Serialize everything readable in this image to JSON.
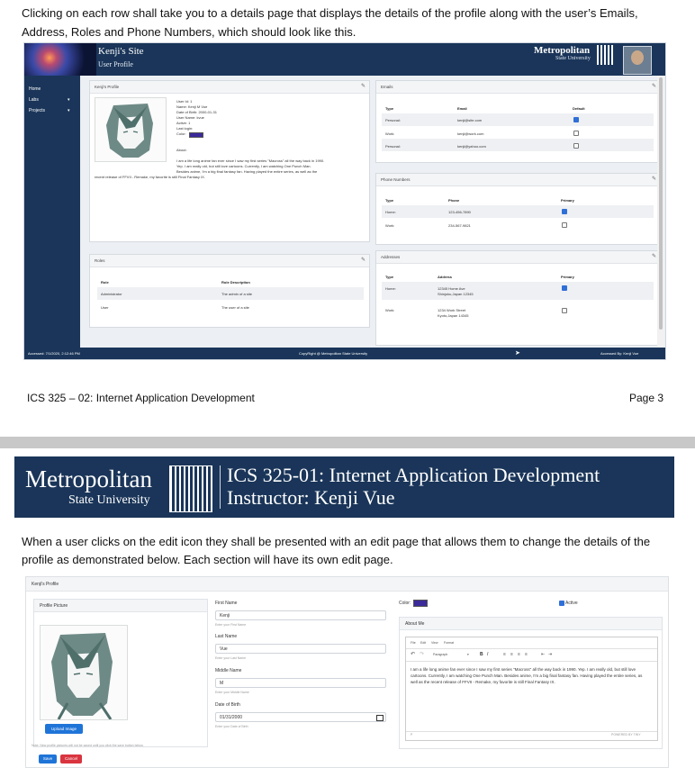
{
  "intro": "Clicking on each row shall take you to a details page that displays the details of the profile along with the user’s Emails, Address, Roles and Phone Numbers, which should look like this.",
  "shot1": {
    "site_title": "Kenji's Site",
    "site_subtitle": "User Profile",
    "logo_main": "Metropolitan",
    "logo_sub": "State University",
    "sidebar": [
      {
        "label": "Home",
        "chevron": ""
      },
      {
        "label": "Labs",
        "chevron": "▾"
      },
      {
        "label": "Projects",
        "chevron": "▾"
      }
    ],
    "edit_icon": "✎",
    "profile": {
      "header": "Kenji's Profile",
      "details": [
        "User Id: 1",
        "Name: Kenji M Vue",
        "Date of Birth: 2000-01-31",
        "User Name: kvue",
        "Active: 1",
        "Last login:",
        "Color:"
      ],
      "color": "#3b2a9a",
      "about_label": "About:",
      "about_lines": [
        "I am a life long anime fan ever since I saw my first series \"Macross\" all the way back in 1990.",
        "Yep. I am really old, but still love cartoons. Currently, I am watching One Punch Man.",
        "Besides anime, I'm a big final fantasy fan. Having played the entire series, as well as the",
        "recent release of FFVII - Remake, my favorite is still Final Fantasy IX."
      ]
    },
    "roles": {
      "header": "Roles",
      "columns": [
        "Role",
        "Role Description"
      ],
      "rows": [
        [
          "Administrator",
          "The admin of a site"
        ],
        [
          "User",
          "The user of a site"
        ]
      ]
    },
    "emails": {
      "header": "Emails",
      "columns": [
        "Type",
        "Email",
        "Default"
      ],
      "rows": [
        {
          "type": "Personal:",
          "value": "kenji@site.com",
          "checked": true
        },
        {
          "type": "Work:",
          "value": "kenji@work.com",
          "checked": false
        },
        {
          "type": "Personal:",
          "value": "kenji@yahoo.com",
          "checked": false
        }
      ]
    },
    "phones": {
      "header": "Phone Numbers",
      "columns": [
        "Type",
        "Phone",
        "Primary"
      ],
      "rows": [
        {
          "type": "Home:",
          "value": "123-456-7890",
          "checked": true
        },
        {
          "type": "Work:",
          "value": "234-567-9821",
          "checked": false
        }
      ]
    },
    "addresses": {
      "header": "Addresses",
      "columns": [
        "Type",
        "Address",
        "Primary"
      ],
      "rows": [
        {
          "type": "Home:",
          "line1": "12345 Home Ave",
          "line2": "Shinjuku,Japan 12345",
          "checked": true
        },
        {
          "type": "Work:",
          "line1": "1234 Work Street",
          "line2": "Kyoto,Japan 14345",
          "checked": false
        }
      ]
    },
    "footer_left": "Accessed: 7/1/2020, 2:12:46 PM",
    "footer_center": "CopyRight @ Metropolitan State University",
    "footer_right": "Accessed By: Kenji Vue"
  },
  "page_footer": {
    "left": "ICS 325 – 02: Internet Application Development",
    "right": "Page 3"
  },
  "banner": {
    "logo_main": "Metropolitan",
    "logo_sub": "State University",
    "line1": "ICS 325-01: Internet Application Development",
    "line2": "Instructor: Kenji Vue"
  },
  "edit_intro": "When a user clicks on the edit icon they shall be presented with an edit page that allows them to change the details of the profile as demonstrated below.  Each section will have its own edit page.",
  "shot2": {
    "header": "Kenji's Profile",
    "picture_label": "Profile Picture",
    "upload_label": "Upload Image",
    "note": "Note: New profile pictures will not be saved until you click the save button below.",
    "save_label": "Save",
    "cancel_label": "Cancel",
    "first_name": {
      "label": "First Name",
      "value": "Kenji",
      "hint": "Enter your First Name"
    },
    "last_name": {
      "label": "Last Name",
      "value": "Vue",
      "hint": "Enter your Last Name"
    },
    "middle_name": {
      "label": "Middle Name",
      "value": "M",
      "hint": "Enter your Middle Name"
    },
    "dob": {
      "label": "Date of Birth",
      "value": "01/31/2000",
      "hint": "Enter your Date of Birth"
    },
    "color_label": "Color:",
    "color": "#3b2a9a",
    "active_label": "Active",
    "active_checked": true,
    "about_label": "About Me",
    "editor_menu": [
      "File",
      "Edit",
      "View",
      "Format"
    ],
    "paragraph_select": "Paragraph",
    "about_text": "I am a life long anime fan ever since I saw my first series \"Macross\" all the way back in 1990. Yep. I am really old, but still love cartoons. Currently, I am watching One Punch Man. Besides anime, I'm a big final fantasy fan. Having played the entire series, as well as the recent release of FFVII - Remake, my favorite is still Final Fantasy IX.",
    "editor_footer_left": "P",
    "editor_footer_right": "POWERED BY TINY"
  }
}
